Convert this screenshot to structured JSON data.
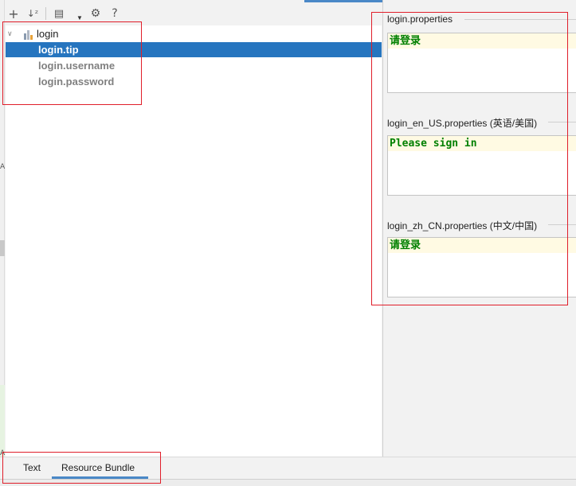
{
  "toolbar": {
    "buttons": [
      {
        "icon": "plus-icon",
        "glyph": "+"
      },
      {
        "icon": "sort-alpha-icon",
        "glyph": "↓ᶻ"
      },
      {
        "icon": "group-by-icon",
        "glyph": "▤"
      },
      {
        "icon": "gear-icon",
        "glyph": "⚙"
      },
      {
        "icon": "help-icon",
        "glyph": "?"
      }
    ]
  },
  "tree": {
    "bundle": {
      "label": "login",
      "expanded": true
    },
    "keys": [
      {
        "label": "login.tip",
        "selected": true
      },
      {
        "label": "login.username",
        "selected": false
      },
      {
        "label": "login.password",
        "selected": false
      }
    ]
  },
  "properties": [
    {
      "file": "login.properties",
      "value": "请登录"
    },
    {
      "file": "login_en_US.properties (英语/美国)",
      "value": "Please sign in"
    },
    {
      "file": "login_zh_CN.properties (中文/中国)",
      "value": "请登录"
    }
  ],
  "tabs": {
    "items": [
      {
        "label": "Text",
        "active": false
      },
      {
        "label": "Resource Bundle",
        "active": true
      }
    ]
  },
  "colors": {
    "selection": "#2675bf",
    "accent": "#4a88c7",
    "value_text": "#008000",
    "value_highlight": "#fffae3",
    "annotation": "#e01e2a"
  }
}
